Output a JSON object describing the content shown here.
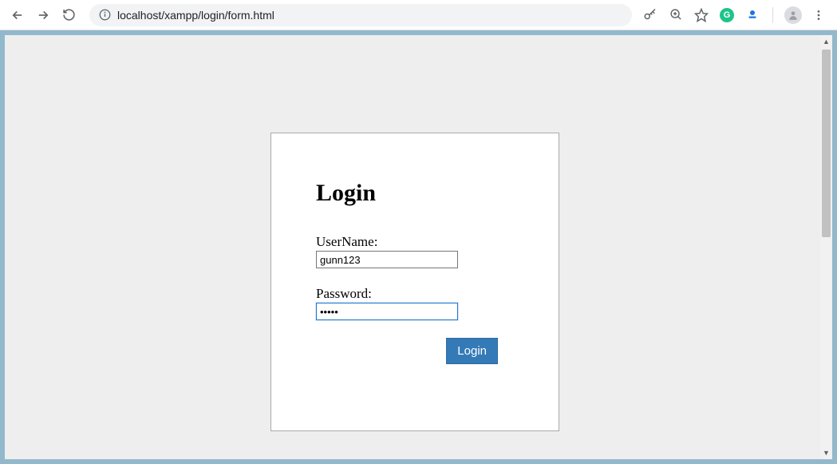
{
  "browser": {
    "url": "localhost/xampp/login/form.html"
  },
  "form": {
    "title": "Login",
    "username_label": "UserName:",
    "username_value": "gunn123",
    "password_label": "Password:",
    "password_value": "•••••",
    "submit_label": "Login"
  }
}
